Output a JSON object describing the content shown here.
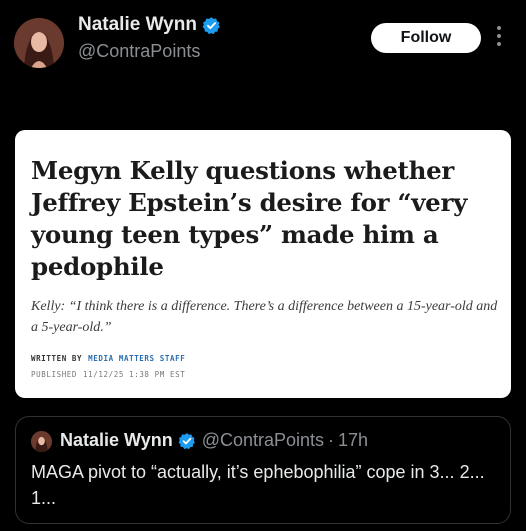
{
  "post": {
    "author_name": "Natalie Wynn",
    "author_handle": "@ContraPoints",
    "follow_label": "Follow"
  },
  "article": {
    "headline": "Megyn Kelly questions whether Jeffrey Epstein’s desire for “very young teen types” made him a pedophile",
    "dek": "Kelly: “I think there is a difference. There’s a difference between a 15-year-old and a 5-year-old.”",
    "written_by_label": "WRITTEN BY",
    "author": "MEDIA MATTERS STAFF",
    "published_label": "PUBLISHED",
    "published_date": "11/12/25 1:38 PM EST"
  },
  "quoted_post": {
    "author_name": "Natalie Wynn",
    "author_handle": "@ContraPoints",
    "separator": "·",
    "time": "17h",
    "text": "MAGA pivot to “actually, it’s ephebophilia” cope in 3... 2... 1..."
  },
  "colors": {
    "background": "#000000",
    "verified_badge": "#1d9bf0",
    "follow_button": "#ffffff",
    "byline_author": "#2b6fb0"
  },
  "icons": [
    "verified-badge-icon",
    "more-options-icon"
  ]
}
